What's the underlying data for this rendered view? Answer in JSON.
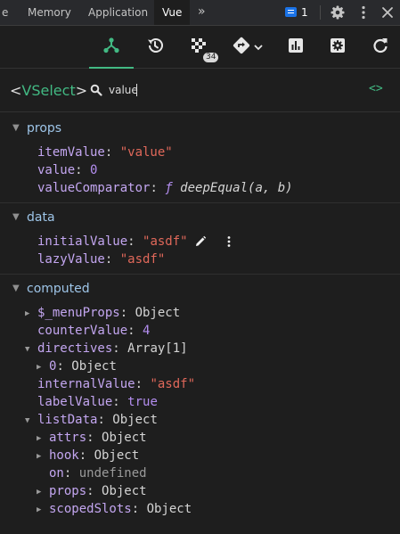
{
  "devtools_tabs": [
    {
      "label": "e",
      "active": false
    },
    {
      "label": "Memory",
      "active": false
    },
    {
      "label": "Application",
      "active": false
    },
    {
      "label": "Vue",
      "active": true
    }
  ],
  "overflow_label": "»",
  "issues_count": "1",
  "toolbar": {
    "events_badge": "34"
  },
  "inspector": {
    "component_open": "<",
    "component_name": "VSelect",
    "component_close": ">",
    "filter_value": "value",
    "open_source_label": "<>"
  },
  "sections": {
    "props": {
      "title": "props",
      "rows": [
        {
          "key": "itemValue",
          "value": "\"value\"",
          "type": "string"
        },
        {
          "key": "value",
          "value": "0",
          "type": "number"
        },
        {
          "key": "valueComparator",
          "fn_symbol": "ƒ",
          "value": "deepEqual(a, b)",
          "type": "function"
        }
      ]
    },
    "data": {
      "title": "data",
      "rows": [
        {
          "key": "initialValue",
          "value": "\"asdf\"",
          "type": "string"
        },
        {
          "key": "lazyValue",
          "value": "\"asdf\"",
          "type": "string"
        }
      ]
    },
    "computed": {
      "title": "computed",
      "rows": [
        {
          "key": "$_menuProps",
          "value": "Object",
          "type": "object",
          "expander": "▶"
        },
        {
          "key": "counterValue",
          "value": "4",
          "type": "number"
        },
        {
          "key": "directives",
          "value": "Array[1]",
          "type": "object",
          "expander": "▼"
        },
        {
          "key": "0",
          "value": "Object",
          "type": "object",
          "expander": "▶"
        },
        {
          "key": "internalValue",
          "value": "\"asdf\"",
          "type": "string"
        },
        {
          "key": "labelValue",
          "value": "true",
          "type": "bool"
        },
        {
          "key": "listData",
          "value": "Object",
          "type": "object",
          "expander": "▼"
        },
        {
          "key": "attrs",
          "value": "Object",
          "type": "object",
          "expander": "▶"
        },
        {
          "key": "hook",
          "value": "Object",
          "type": "object",
          "expander": "▶"
        },
        {
          "key": "on",
          "value": "undefined",
          "type": "undef"
        },
        {
          "key": "props",
          "value": "Object",
          "type": "object",
          "expander": "▶"
        },
        {
          "key": "scopedSlots",
          "value": "Object",
          "type": "object",
          "expander": "▶"
        }
      ]
    }
  },
  "section_arrow": "▼",
  "colors": {
    "accent": "#42b983",
    "string": "#e0685a",
    "key": "#c3a6f0",
    "section": "#9ec5e8",
    "background": "#1e1e1e"
  }
}
